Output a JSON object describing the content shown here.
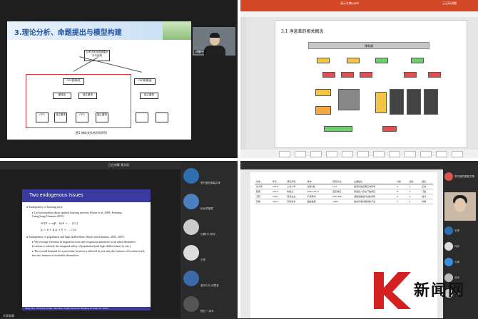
{
  "top_left": {
    "slide_title": "3.理论分析、命题提出与模型构建",
    "caption": "图1 博弈关系的时间序列",
    "nodes": [
      "公司决定信息披露水平与结构",
      "CEO知情/低",
      "董事会",
      "CEO知情/高",
      "独立董事",
      "独立董事",
      "CEO",
      "独立董事",
      "CEO",
      "独立董事"
    ],
    "camera_label": "讲解中"
  },
  "top_right": {
    "window_title": "演示文稿.pptx",
    "user": "王石珂讲解",
    "slide_title": "3.1 净息差的相关概念",
    "center_label": "净利润"
  },
  "bottom_left": {
    "toolbar_text": "正在讲解 黄文凯",
    "slide_title": "Two endogenous Issues",
    "bullet1_title": "Endogeneity of housing price",
    "bullet1_sub": "Use information about optimal housing services (Bayer et al.,2008; Freeman, Liang,Song,Timmins,2019 )",
    "eq1": "WTP = α/β · H/P + ... (11)",
    "eq2": "p = δ + β·X + ξ + ... (12)",
    "bullet2_title": "Endogeneity of population and high skilled share (Bayer and Timmins, 2005, 2007)",
    "bullet2_sub1": "We leverage variation in migration costs and exogenous amenities in all other alternative locations to identify the marginal utility of population/(and high skilled share) in city j.",
    "bullet2_sub2": "The overall demand for a particular location is affected by not only the features of location itself, but also features of available alternatives.",
    "footer": "Yang Sha, Timmins (Duke, Yale Nus, Duke)   Seminar Meeting   October 12, 2022",
    "corner_label": "共享屏幕"
  },
  "participants": [
    {
      "name": "李竹宽的屏幕共享",
      "color": "#2f6fb0"
    },
    {
      "name": "纪女李银源",
      "color": "#4a7fc0"
    },
    {
      "name": "日期行1-陈宇",
      "color": "#cccccc"
    },
    {
      "name": "王梓",
      "color": "#dddddd"
    },
    {
      "name": "金宇小凡-何思宜",
      "color": "#3a6aa8"
    },
    {
      "name": "陈石一-何宇",
      "color": "#555555"
    }
  ],
  "bottom_right": {
    "table_headers": [
      "作者",
      "年份",
      "研究对象",
      "样本",
      "研究方法",
      "主要结论",
      "分类",
      "指标",
      "结论"
    ],
    "table_rows": [
      [
        "刘大伟",
        "2018",
        "上市公司",
        "全部A股",
        "OLS",
        "政府补贴显著正向影响",
        "A",
        "1",
        "正向"
      ],
      [
        "程美",
        "2019",
        "制造业",
        "2009-2017",
        "固定效应",
        "研发投入存在门槛效应",
        "B",
        "2",
        "门槛"
      ],
      [
        "王晓",
        "2020",
        "民营企业",
        "沪深两市",
        "PSM-DID",
        "减税政策提升创新效率",
        "A",
        "3",
        "提升"
      ],
      [
        "张敏",
        "2021",
        "高新技术",
        "面板数据",
        "GMM",
        "融资约束抑制创新产出",
        "C",
        "4",
        "抑制"
      ]
    ],
    "rail": [
      {
        "name": "李竹宽的屏幕共享",
        "color": "#d9534f"
      },
      {
        "name": "王梓",
        "color": "#2f6fb0"
      },
      {
        "name": "何宇",
        "color": "#dddddd"
      },
      {
        "name": "九泽",
        "color": "#3a8de0"
      },
      {
        "name": "刘中",
        "color": "#bbbbbb"
      },
      {
        "name": "金小凡",
        "color": "#cccccc"
      }
    ]
  },
  "watermark": {
    "text": "新闻网"
  }
}
